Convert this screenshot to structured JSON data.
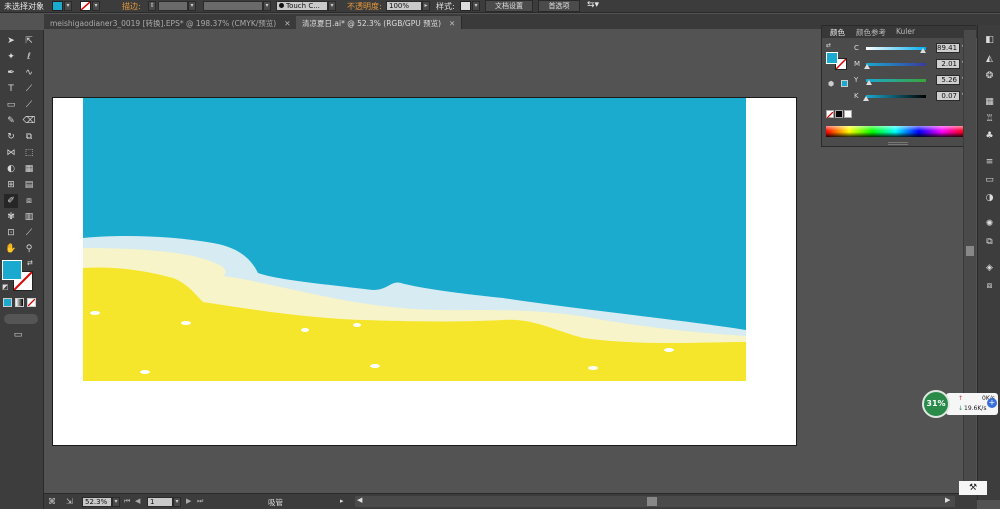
{
  "control_bar": {
    "selection_status": "未选择对象",
    "stroke_label": "描边:",
    "brush_name": "Touch C...",
    "opacity_label": "不透明度:",
    "opacity_value": "100%",
    "style_label": "样式:",
    "document_setup_button": "文档设置",
    "preferences_button": "首选项"
  },
  "tabs": [
    {
      "label": "meishigaodianer3_0019 [转换].EPS* @ 198.37% (CMYK/预览)",
      "close": "✕"
    },
    {
      "label": "清凉夏日.ai* @ 52.3% (RGB/GPU 预览)",
      "close": "✕"
    }
  ],
  "color_panel": {
    "tabs": [
      "颜色",
      "颜色参考",
      "Kuler"
    ],
    "channels": [
      {
        "name": "C",
        "value": "89.41",
        "unit": "%",
        "level": 0.894
      },
      {
        "name": "M",
        "value": "2.01",
        "unit": "%",
        "level": 0.02
      },
      {
        "name": "Y",
        "value": "5.26",
        "unit": "%",
        "level": 0.053
      },
      {
        "name": "K",
        "value": "0.07",
        "unit": "%",
        "level": 0.001
      }
    ]
  },
  "status_bar": {
    "zoom": "52.3%",
    "artboard_number": "1",
    "tool_name": "吸管"
  },
  "network_widget": {
    "cpu_percent": "31%",
    "upload": "0K/s",
    "download": "19.6K/s"
  },
  "colors": {
    "fill": "#1aa9cf",
    "sea": "#1aabcf",
    "sand": "#f5e62b",
    "foam": "#d7ebf2",
    "wet_sand": "#f8f4c9"
  }
}
